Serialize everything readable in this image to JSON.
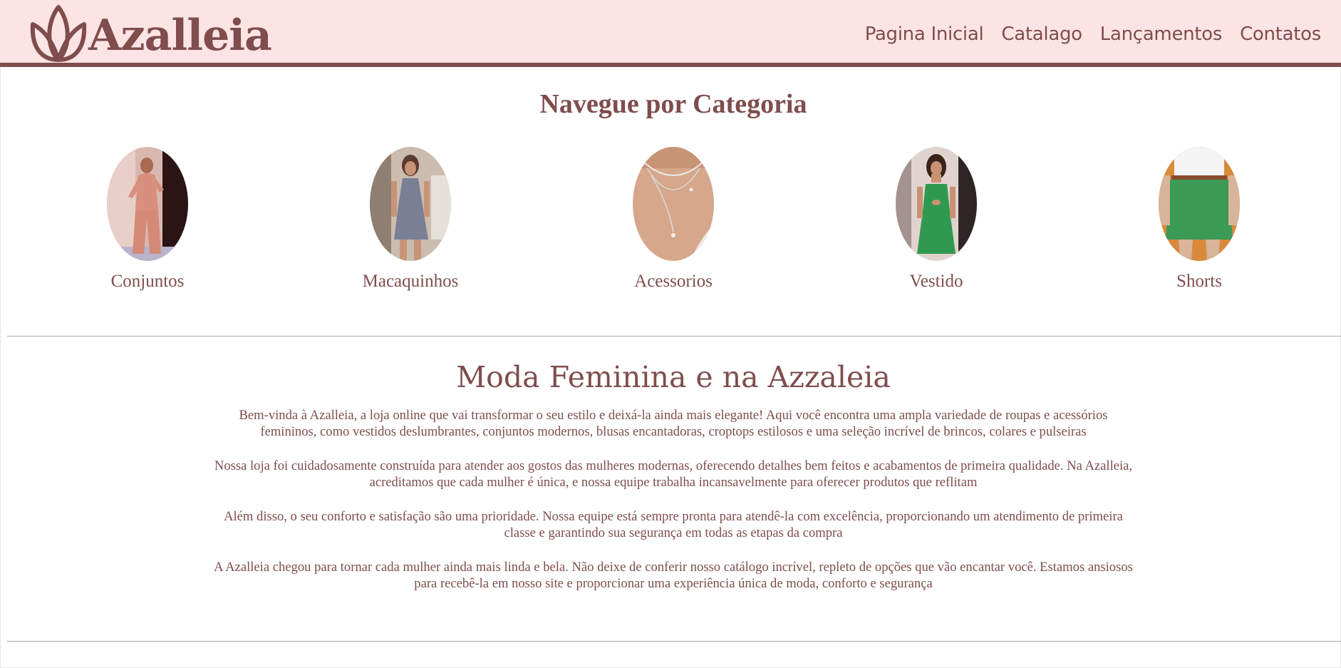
{
  "header": {
    "logo_text": "Azalleia",
    "nav": [
      {
        "label": "Pagina Inicial"
      },
      {
        "label": "Catalago"
      },
      {
        "label": "Lançamentos"
      },
      {
        "label": "Contatos"
      }
    ]
  },
  "categories": {
    "title": "Navegue por Categoria",
    "items": [
      {
        "label": "Conjuntos"
      },
      {
        "label": "Macaquinhos"
      },
      {
        "label": "Acessorios"
      },
      {
        "label": "Vestido"
      },
      {
        "label": "Shorts"
      }
    ]
  },
  "about": {
    "title": "Moda Feminina e na Azzaleia",
    "paragraphs": [
      "Bem-vinda à Azalleia, a loja online que vai transformar o seu estilo e deixá-la ainda mais elegante! Aqui você encontra uma ampla variedade de roupas e acessórios femininos, como vestidos deslumbrantes, conjuntos modernos, blusas encantadoras, croptops estilosos e uma seleção incrível de brincos, colares e pulseiras",
      "Nossa loja foi cuidadosamente construída para atender aos gostos das mulheres modernas, oferecendo detalhes bem feitos e acabamentos de primeira qualidade. Na Azalleia, acreditamos que cada mulher é única, e nossa equipe trabalha incansavelmente para oferecer produtos que reflitam",
      "Além disso, o seu conforto e satisfação são uma prioridade. Nossa equipe está sempre pronta para atendê-la com excelência, proporcionando um atendimento de primeira classe e garantindo sua segurança em todas as etapas da compra",
      "A Azalleia chegou para tornar cada mulher ainda mais linda e bela. Não deixe de conferir nosso catálogo incrível, repleto de opções que vão encantar você. Estamos ansiosos para recebê-la em nosso site e proporcionar uma experiência única de moda, conforto e segurança"
    ]
  },
  "colors": {
    "brand": "#7f4d4d",
    "header_bg": "#fde4e4",
    "background": "#ffffff"
  },
  "icons": [
    "lotus-logo-icon"
  ]
}
